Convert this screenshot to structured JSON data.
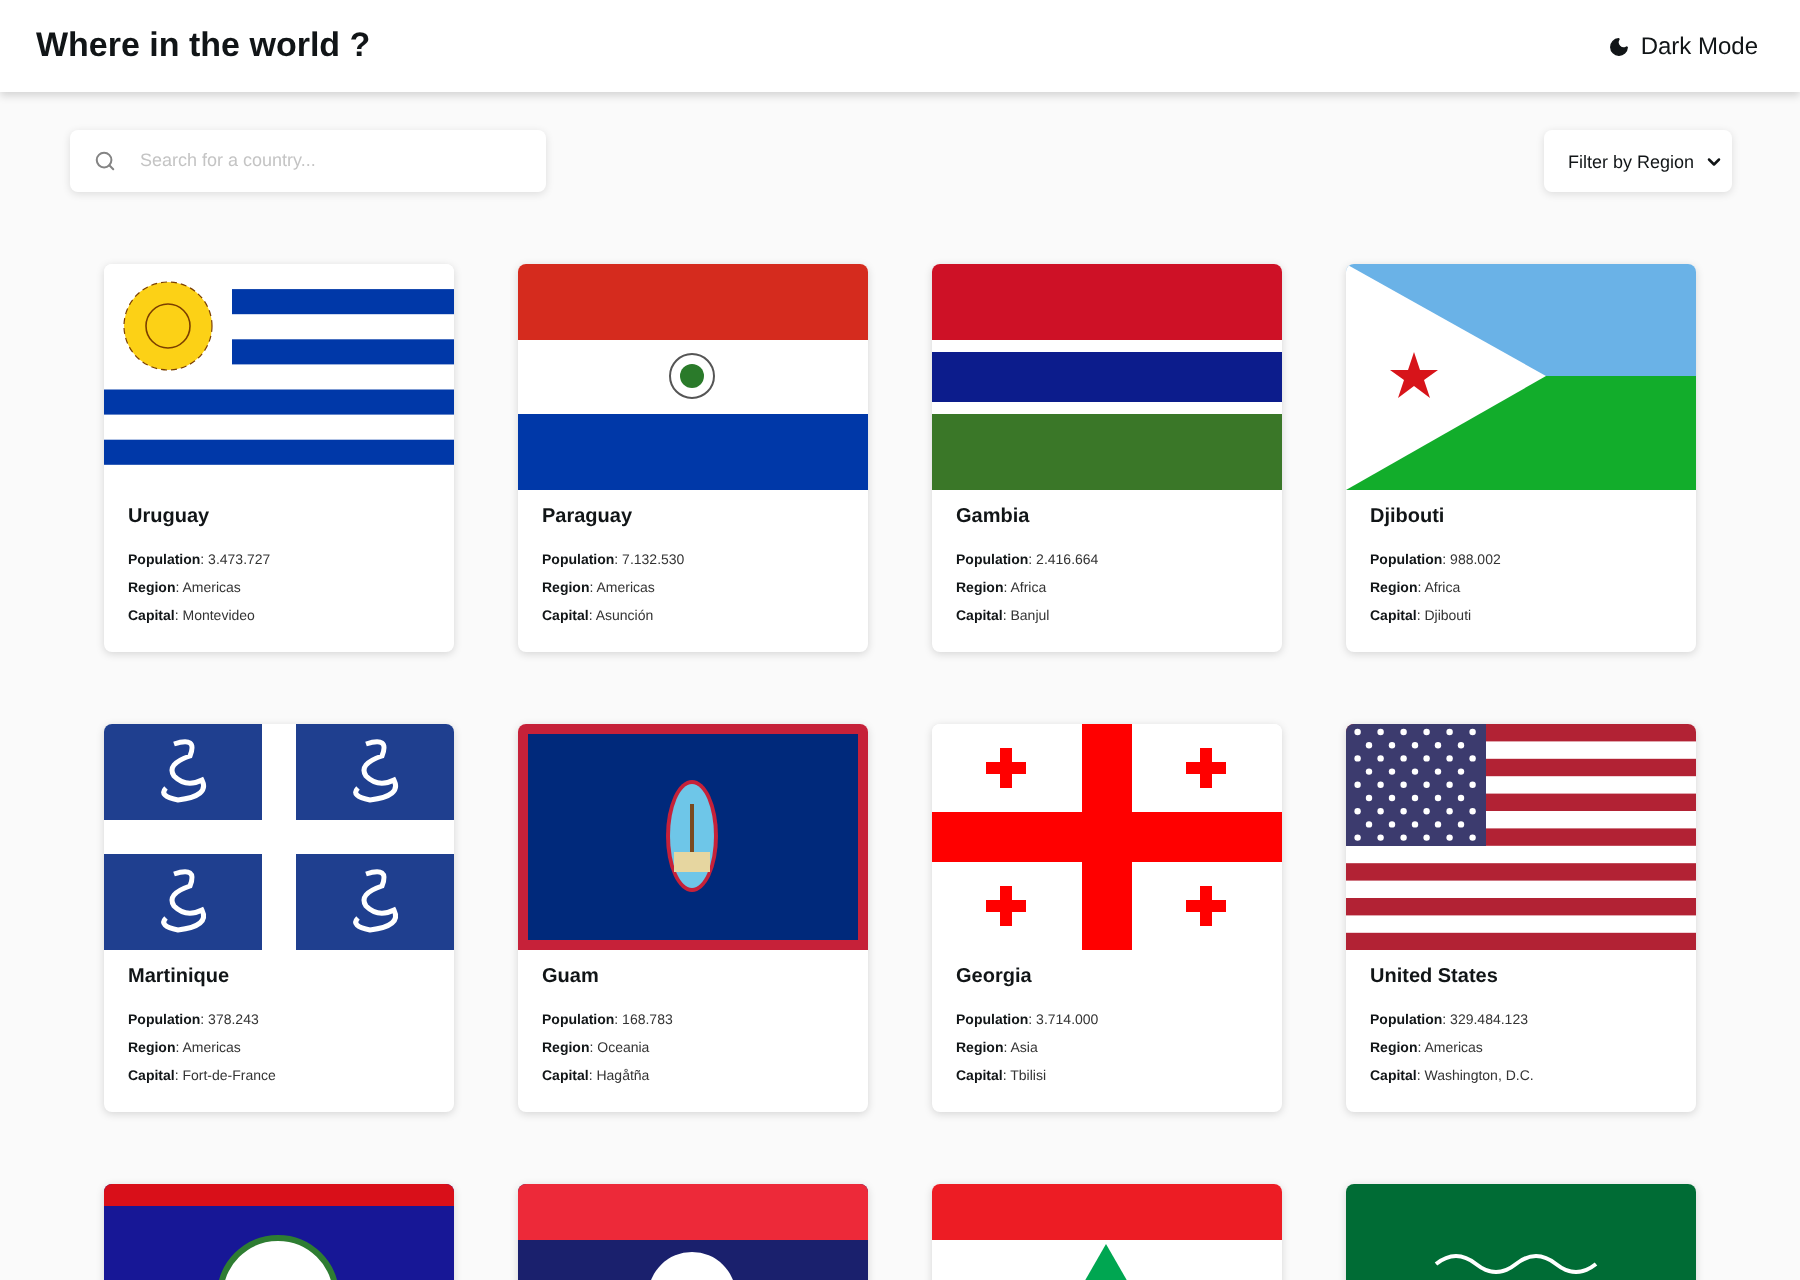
{
  "header": {
    "title": "Where in the world ?",
    "theme_toggle": "Dark Mode"
  },
  "search": {
    "placeholder": "Search for a country..."
  },
  "filter": {
    "label": "Filter by Region"
  },
  "countries": [
    {
      "kind": "uruguay",
      "name": "Uruguay",
      "lines": [
        "**Population**: 3.473.727",
        "**Region**: Americas",
        "**Capital**: Montevideo"
      ]
    },
    {
      "kind": "paraguay",
      "name": "Paraguay",
      "lines": [
        "**Population**: 7.132.530",
        "**Region**: Americas",
        "**Capital**: Asunción"
      ]
    },
    {
      "kind": "gambia",
      "name": "Gambia",
      "lines": [
        "**Population**: 2.416.664",
        "**Region**: Africa",
        "**Capital**: Banjul"
      ]
    },
    {
      "kind": "djibouti",
      "name": "Djibouti",
      "lines": [
        "**Population**: 988.002",
        "**Region**: Africa",
        "**Capital**: Djibouti"
      ]
    },
    {
      "kind": "martinique",
      "name": "Martinique",
      "lines": [
        "**Population**: 378.243",
        "**Region**: Americas",
        "**Capital**: Fort-de-France"
      ]
    },
    {
      "kind": "guam",
      "name": "Guam",
      "lines": [
        "**Population**: 168.783",
        "**Region**: Oceania",
        "**Capital**: Hagåtña"
      ]
    },
    {
      "kind": "georgia",
      "name": "Georgia",
      "lines": [
        "**Population**: 3.714.000",
        "**Region**: Asia",
        "**Capital**: Tbilisi"
      ]
    },
    {
      "kind": "united_states",
      "name": "United States",
      "lines": [
        "**Population**: 329.484.123",
        "**Region**: Americas",
        "**Capital**: Washington, D.C."
      ]
    },
    {
      "kind": "belize"
    },
    {
      "kind": "laos"
    },
    {
      "kind": "lebanon"
    },
    {
      "kind": "saudi_arabia"
    }
  ]
}
